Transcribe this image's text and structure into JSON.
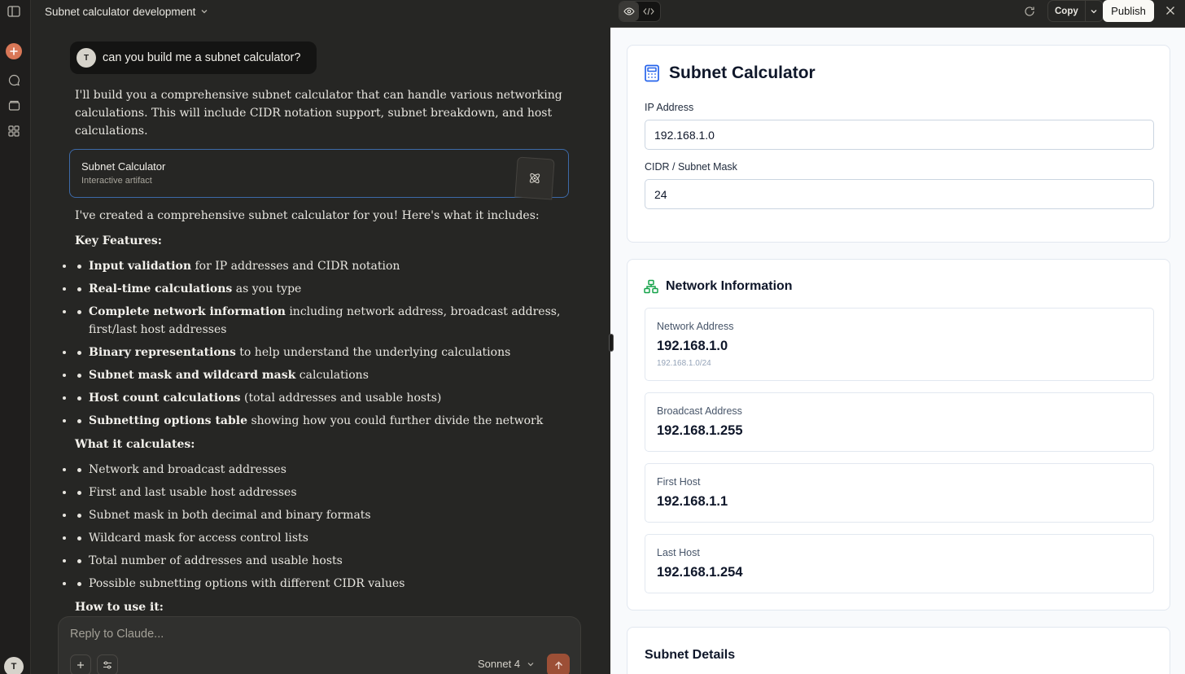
{
  "chat": {
    "title": "Subnet calculator development",
    "user_initial": "T",
    "user_message": "can you build me a subnet calculator?",
    "intro": "I'll build you a comprehensive subnet calculator that can handle various networking calculations. This will include CIDR notation support, subnet breakdown, and host calculations.",
    "artifact": {
      "title": "Subnet Calculator",
      "subtitle": "Interactive artifact"
    },
    "created": "I've created a comprehensive subnet calculator for you! Here's what it includes:",
    "key_features_heading": "Key Features:",
    "key_features": [
      {
        "bold": "Input validation",
        "rest": " for IP addresses and CIDR notation"
      },
      {
        "bold": "Real-time calculations",
        "rest": " as you type"
      },
      {
        "bold": "Complete network information",
        "rest": " including network address, broadcast address, first/last host addresses"
      },
      {
        "bold": "Binary representations",
        "rest": " to help understand the underlying calculations"
      },
      {
        "bold": "Subnet mask and wildcard mask",
        "rest": " calculations"
      },
      {
        "bold": "Host count calculations",
        "rest": " (total addresses and usable hosts)"
      },
      {
        "bold": "Subnetting options table",
        "rest": " showing how you could further divide the network"
      }
    ],
    "calculates_heading": "What it calculates:",
    "calculates": [
      "Network and broadcast addresses",
      "First and last usable host addresses",
      "Subnet mask in both decimal and binary formats",
      "Wildcard mask for access control lists",
      "Total number of addresses and usable hosts",
      "Possible subnetting options with different CIDR values"
    ],
    "how_heading": "How to use it:"
  },
  "composer": {
    "placeholder": "Reply to Claude...",
    "model": "Sonnet 4"
  },
  "rail": {
    "avatar": "T"
  },
  "panel": {
    "copy_label": "Copy",
    "publish_label": "Publish",
    "app": {
      "title": "Subnet Calculator",
      "ip_label": "IP Address",
      "ip_value": "192.168.1.0",
      "cidr_label": "CIDR / Subnet Mask",
      "cidr_value": "24",
      "network_heading": "Network Information",
      "network_address_label": "Network Address",
      "network_address_value": "192.168.1.0",
      "network_address_sub": "192.168.1.0/24",
      "broadcast_label": "Broadcast Address",
      "broadcast_value": "192.168.1.255",
      "first_host_label": "First Host",
      "first_host_value": "192.168.1.1",
      "last_host_label": "Last Host",
      "last_host_value": "192.168.1.254",
      "details_heading": "Subnet Details"
    }
  },
  "colors": {
    "accent": "#d97757",
    "link_border": "#3d6aa8",
    "calculator_icon": "#2563eb",
    "network_icon": "#16a34a"
  }
}
